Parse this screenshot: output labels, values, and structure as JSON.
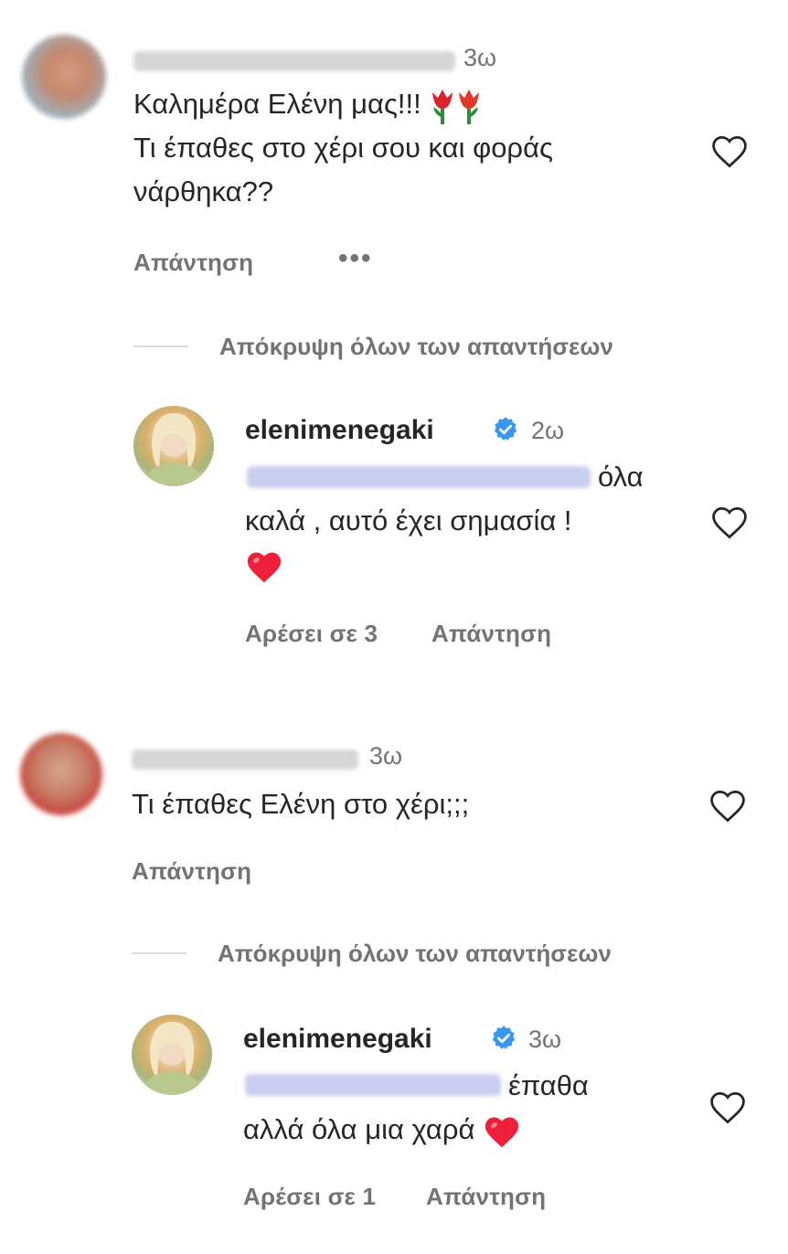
{
  "comments": [
    {
      "time": "3ω",
      "line1": "Καλημέρα Ελένη μας!!!",
      "line2": "Τι έπαθες στο χέρι σου και φοράς",
      "line3": "νάρθηκα??",
      "reply_label": "Απάντηση",
      "more_label": "•••",
      "hide_replies": "Απόκρυψη όλων των απαντήσεων",
      "reply": {
        "username": "elenimenegaki",
        "time": "2ω",
        "line1_after_mention": "όλα",
        "line2": "καλά , αυτό έχει σημασία !",
        "likes": "Αρέσει σε 3",
        "reply_label": "Απάντηση"
      }
    },
    {
      "time": "3ω",
      "line1": "Τι έπαθες Ελένη στο χέρι;;;",
      "reply_label": "Απάντηση",
      "hide_replies": "Απόκρυψη όλων των απαντήσεων",
      "reply": {
        "username": "elenimenegaki",
        "time": "3ω",
        "line1_after_mention": "έπαθα",
        "line2": "αλλά όλα μια χαρά",
        "likes": "Αρέσει σε 1",
        "reply_label": "Απάντηση"
      }
    }
  ],
  "colors": {
    "verified": "#3897f0",
    "heart_red": "#ed1f3a",
    "secondary_text": "#737373"
  }
}
